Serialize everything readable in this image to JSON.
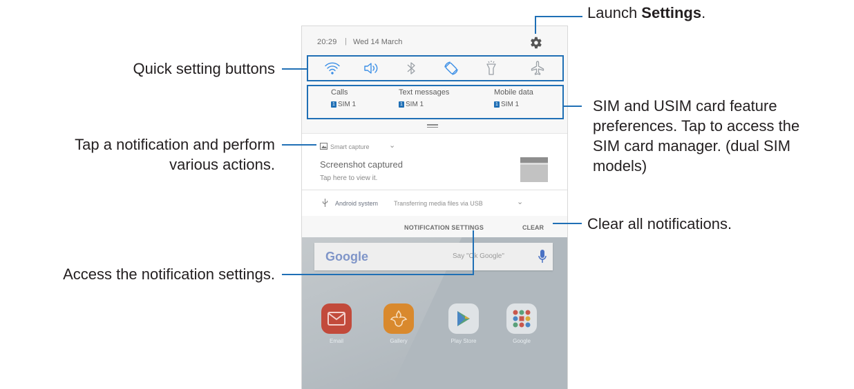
{
  "status_bar": {
    "time": "20:29",
    "separator": "|",
    "date": "Wed 14 March"
  },
  "quick_settings": [
    "wifi-icon",
    "sound-icon",
    "bluetooth-icon",
    "auto-rotate-icon",
    "flashlight-icon",
    "airplane-mode-icon"
  ],
  "sim_preferences": [
    {
      "label": "Calls",
      "badge": "1",
      "value": "SIM 1"
    },
    {
      "label": "Text messages",
      "badge": "1",
      "value": "SIM 1"
    },
    {
      "label": "Mobile data",
      "badge": "1",
      "value": "SIM 1"
    }
  ],
  "notifications": [
    {
      "app": "Smart capture",
      "chevron": "⌄",
      "title": "Screenshot captured",
      "text": "Tap here to view it."
    },
    {
      "app": "Android system",
      "text": "Transferring media files via USB",
      "chevron": "⌄"
    }
  ],
  "actions": {
    "notification_settings": "NOTIFICATION SETTINGS",
    "clear": "CLEAR"
  },
  "home": {
    "google_logo": "Google",
    "google_hint": "Say \"Ok Google\"",
    "apps": [
      "Email",
      "Gallery",
      "Play Store",
      "Google"
    ]
  },
  "callouts": {
    "settings_prefix": "Launch ",
    "settings_bold": "Settings",
    "settings_suffix": ".",
    "quick_settings": "Quick setting buttons",
    "sim_line1": "SIM and USIM card feature",
    "sim_line2": "preferences. Tap to access the",
    "sim_line3": "SIM card manager. (dual SIM",
    "sim_line4": "models)",
    "notif_line1": "Tap a notification and perform",
    "notif_line2": "various actions.",
    "clear_all": "Clear all notifications.",
    "access_settings": "Access the notification settings."
  },
  "colors": {
    "accent": "#1f6fb5",
    "icon_active": "#3a8ee6",
    "icon_inactive": "#9aa0a6"
  }
}
